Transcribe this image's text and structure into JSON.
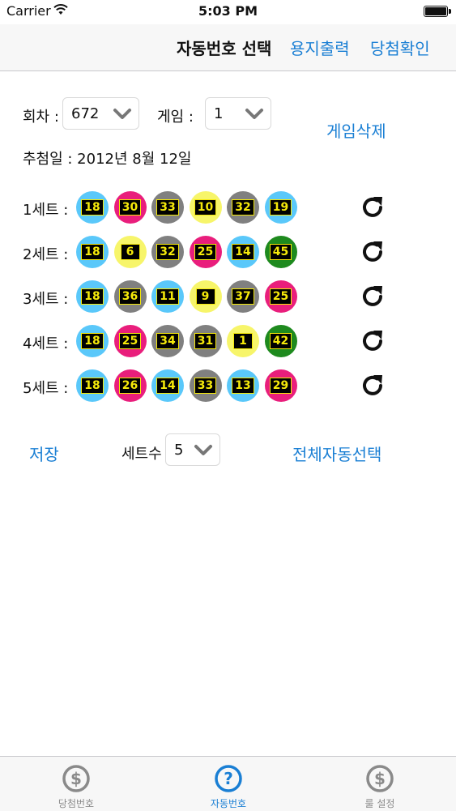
{
  "status": {
    "carrier": "Carrier",
    "time": "5:03 PM"
  },
  "nav": {
    "title": "자동번호 선택",
    "print": "용지출력",
    "check": "당첨확인"
  },
  "form": {
    "round_label": "회차 :",
    "round_value": "672",
    "game_label": "게임 :",
    "game_value": "1",
    "delete_game": "게임삭제",
    "draw_date": "추첨일 : 2012년 8월 12일"
  },
  "sets": [
    {
      "label": "1세트 :",
      "balls": [
        {
          "n": "18",
          "color": "#5ac8fa"
        },
        {
          "n": "30",
          "color": "#e91e7c"
        },
        {
          "n": "33",
          "color": "#808080"
        },
        {
          "n": "10",
          "color": "#f7f56a"
        },
        {
          "n": "32",
          "color": "#808080"
        },
        {
          "n": "19",
          "color": "#5ac8fa"
        }
      ]
    },
    {
      "label": "2세트 :",
      "balls": [
        {
          "n": "18",
          "color": "#5ac8fa"
        },
        {
          "n": "6",
          "color": "#f7f56a"
        },
        {
          "n": "32",
          "color": "#808080"
        },
        {
          "n": "25",
          "color": "#e91e7c"
        },
        {
          "n": "14",
          "color": "#5ac8fa"
        },
        {
          "n": "45",
          "color": "#1e8a1e"
        }
      ]
    },
    {
      "label": "3세트 :",
      "balls": [
        {
          "n": "18",
          "color": "#5ac8fa"
        },
        {
          "n": "36",
          "color": "#808080"
        },
        {
          "n": "11",
          "color": "#5ac8fa"
        },
        {
          "n": "9",
          "color": "#f7f56a"
        },
        {
          "n": "37",
          "color": "#808080"
        },
        {
          "n": "25",
          "color": "#e91e7c"
        }
      ]
    },
    {
      "label": "4세트 :",
      "balls": [
        {
          "n": "18",
          "color": "#5ac8fa"
        },
        {
          "n": "25",
          "color": "#e91e7c"
        },
        {
          "n": "34",
          "color": "#808080"
        },
        {
          "n": "31",
          "color": "#808080"
        },
        {
          "n": "1",
          "color": "#f7f56a"
        },
        {
          "n": "42",
          "color": "#1e8a1e"
        }
      ]
    },
    {
      "label": "5세트 :",
      "balls": [
        {
          "n": "18",
          "color": "#5ac8fa"
        },
        {
          "n": "26",
          "color": "#e91e7c"
        },
        {
          "n": "14",
          "color": "#5ac8fa"
        },
        {
          "n": "33",
          "color": "#808080"
        },
        {
          "n": "13",
          "color": "#5ac8fa"
        },
        {
          "n": "29",
          "color": "#e91e7c"
        }
      ]
    }
  ],
  "bottom": {
    "save": "저장",
    "set_count_label": "세트수",
    "set_count_value": "5",
    "auto_all": "전체자동선택"
  },
  "tabs": [
    {
      "label": "당첨번호",
      "icon": "dollar-icon",
      "active": false
    },
    {
      "label": "자동번호",
      "icon": "question-icon",
      "active": true
    },
    {
      "label": "룰 설정",
      "icon": "dollar-icon",
      "active": false
    }
  ],
  "colors": {
    "accent": "#1a7fd4",
    "ball_text": "#f5e90a"
  }
}
